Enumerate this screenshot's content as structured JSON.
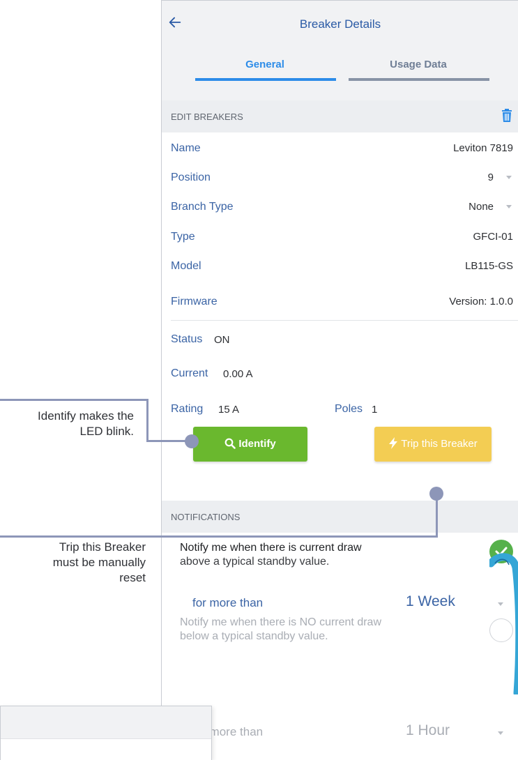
{
  "header": {
    "title": "Breaker Details",
    "back_icon": "arrow-left-icon"
  },
  "tabs": [
    {
      "label": "General",
      "active": true
    },
    {
      "label": "Usage Data",
      "active": false
    }
  ],
  "edit_section": {
    "header": "EDIT BREAKERS",
    "delete_icon": "trash-icon",
    "rows": [
      {
        "label": "Name",
        "value": "Leviton 7819"
      },
      {
        "label": "Position",
        "value": "9",
        "dropdown": true
      },
      {
        "label": "Branch Type",
        "value": "None",
        "dropdown": true
      },
      {
        "label": "Type",
        "value": "GFCI-01"
      },
      {
        "label": "Model",
        "value": "LB115-GS"
      },
      {
        "label": "Firmware",
        "value": "Version: 1.0.0"
      }
    ]
  },
  "status": {
    "status_label": "Status",
    "status_value": "ON",
    "current_label": "Current",
    "current_value": "0.00 A",
    "rating_label": "Rating",
    "rating_value": "15 A",
    "poles_label": "Poles",
    "poles_value": "1"
  },
  "buttons": {
    "identify": "Identify",
    "identify_icon": "search-icon",
    "trip": "Trip this Breaker",
    "trip_icon": "lightning-icon"
  },
  "notifications": {
    "header": "NOTIFICATIONS",
    "items": [
      {
        "title": "Notify me when there is current draw",
        "subtitle": "above a typical standby value.",
        "for_label": "for more than",
        "duration": "1 Week",
        "enabled": true
      },
      {
        "title": "Notify me when there is NO current draw",
        "subtitle": "below a typical standby value.",
        "for_label": "for more than",
        "duration": "1 Hour",
        "enabled": false
      }
    ]
  },
  "callouts": {
    "identify_line1": "Identify makes the",
    "identify_line2": "LED blink.",
    "trip_line1": "Trip this Breaker",
    "trip_line2": "must be manually",
    "trip_line3": "reset"
  },
  "colors": {
    "accent_blue": "#2d8ce8",
    "label_blue": "#3b64a5",
    "identify_green": "#6ab82e",
    "trip_yellow": "#f3cd53",
    "toggle_green": "#56b14b",
    "connector": "#8d96b8"
  }
}
